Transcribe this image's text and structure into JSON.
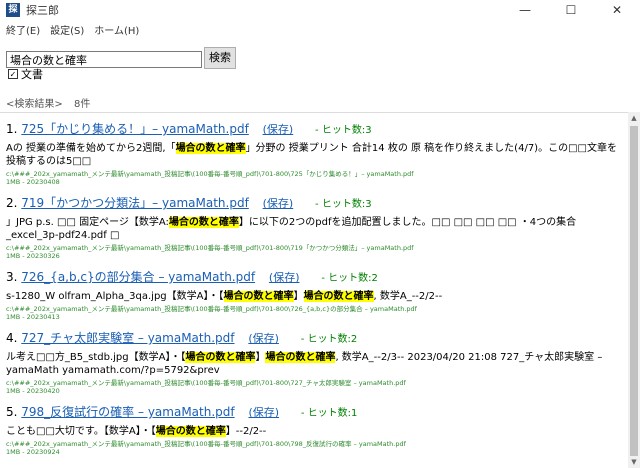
{
  "window": {
    "icon_glyph": "探",
    "title": "探三郎",
    "minimize": "—",
    "maximize": "☐",
    "close": "✕"
  },
  "menu": [
    "終了(E)",
    "設定(S)",
    "ホーム(H)"
  ],
  "search": {
    "value": "場合の数と確率",
    "button_label": "検索",
    "checkbox_label": "文書",
    "checkbox_mark": "✓"
  },
  "result_header": {
    "label": "<検索結果>",
    "count": "8件"
  },
  "results": [
    {
      "num": "1.",
      "title": "725「かじり集める！」– yamaMath.pdf",
      "save": "(保存)",
      "hits": "- ヒット数:3",
      "snippet_before": "Aの 授業の準備を始めてから2週間,「",
      "snippet_hl1": "場合の数と確率",
      "snippet_mid": "」分野の 授業プリント 合計14 枚の 原 稿を作り終えました(4/7)。この□□文章を投稿するのは5□□",
      "snippet_hl2": "",
      "snippet_after": "",
      "path": "c:\\###_202x_yamamath_メンテ最新\\yamamath_投稿記事\\(100番毎-番号順_pdf)\\701-800\\725「かじり集める！」– yamaMath.pdf",
      "meta": "1MB - 20230408"
    },
    {
      "num": "2.",
      "title": "719「かつかつ分類法」– yamaMath.pdf",
      "save": "(保存)",
      "hits": "- ヒット数:3",
      "snippet_before": "」JPG p.s. □□  固定ページ【数学A:",
      "snippet_hl1": "場合の数と確率",
      "snippet_mid": "】に以下の2つのpdfを追加配置しました。□□  □□  □□  □□  ・4つの集合_excel_3p-pdf24.pdf □",
      "snippet_hl2": "",
      "snippet_after": "",
      "path": "c:\\###_202x_yamamath_メンテ最新\\yamamath_投稿記事\\(100番毎-番号順_pdf)\\701-800\\719「かつかつ分類法」– yamaMath.pdf",
      "meta": "1MB - 20230326"
    },
    {
      "num": "3.",
      "title": "726_{a,b,c}の部分集合 – yamaMath.pdf",
      "save": "(保存)",
      "hits": "- ヒット数:2",
      "snippet_before": "s-1280_W olfram_Alpha_3qa.jpg【数学A】・【",
      "snippet_hl1": "場合の数と確率",
      "snippet_mid": "】",
      "snippet_hl2": "場合の数と確率",
      "snippet_after": ", 数学A_--2/2--",
      "path": "c:\\###_202x_yamamath_メンテ最新\\yamamath_投稿記事\\(100番毎-番号順_pdf)\\701-800\\726_{a,b,c}の部分集合 – yamaMath.pdf",
      "meta": "1MB - 20230413"
    },
    {
      "num": "4.",
      "title": "727_チャ太郎実験室 – yamaMath.pdf",
      "save": "(保存)",
      "hits": "- ヒット数:2",
      "snippet_before": "ル考え□□方_B5_stdb.jpg【数学A】・【",
      "snippet_hl1": "場合の数と確率",
      "snippet_mid": "】",
      "snippet_hl2": "場合の数と確率",
      "snippet_after": ", 数学A_--2/3-- 2023/04/20 21:08 727_チャ太郎実験室 – yamaMath yamamath.com/?p=5792&prev",
      "path": "c:\\###_202x_yamamath_メンテ最新\\yamamath_投稿記事\\(100番毎-番号順_pdf)\\701-800\\727_チャ太郎実験室 – yamaMath.pdf",
      "meta": "1MB - 20230420"
    },
    {
      "num": "5.",
      "title": "798_反復試行の確率 – yamaMath.pdf",
      "save": "(保存)",
      "hits": "- ヒット数:1",
      "snippet_before": "ことも□□大切です。【数学A】・【",
      "snippet_hl1": "場合の数と確率",
      "snippet_mid": "】--2/2--",
      "snippet_hl2": "",
      "snippet_after": "",
      "path": "c:\\###_202x_yamamath_メンテ最新\\yamamath_投稿記事\\(100番毎-番号順_pdf)\\701-800\\798_反復試行の確率 – yamaMath.pdf",
      "meta": "1MB - 20230924"
    }
  ]
}
